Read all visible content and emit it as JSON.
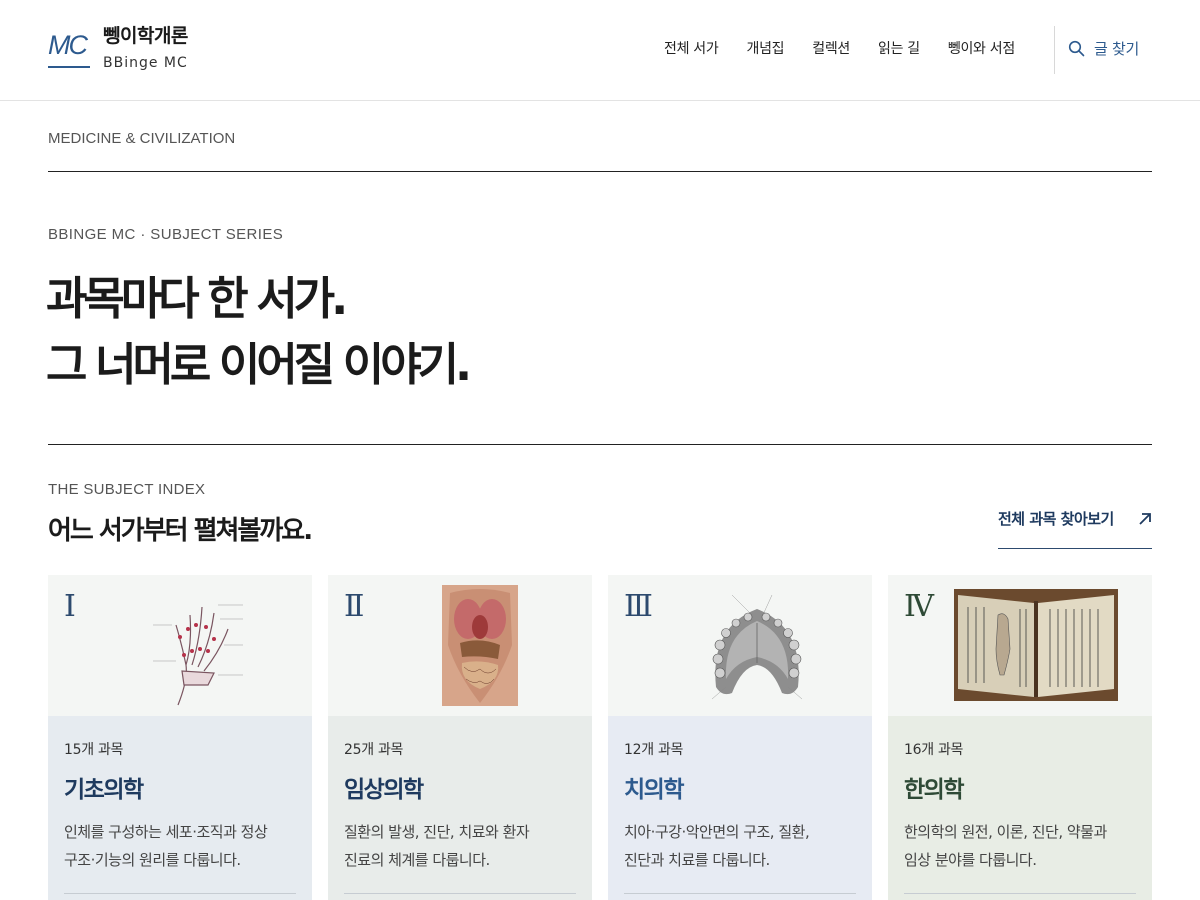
{
  "header": {
    "logo_mark": "MC",
    "logo_title": "뼁이학개론",
    "logo_subtitle": "BBinge MC",
    "nav": [
      "전체 서가",
      "개념집",
      "컬렉션",
      "읽는 길",
      "뼁이와 서점"
    ],
    "search_label": "글 찾기"
  },
  "intro": {
    "kicker": "MEDICINE & CIVILIZATION",
    "series": "BBINGE MC · SUBJECT SERIES",
    "headline_line1": "과목마다 한 서가.",
    "headline_line2": "그 너머로 이어질 이야기."
  },
  "index": {
    "label": "THE SUBJECT INDEX",
    "title": "어느 서가부터 펼쳐볼까요.",
    "browse_label": "전체 과목 찾아보기"
  },
  "cards": [
    {
      "numeral": "Ⅰ",
      "count": "15개 과목",
      "name": "기초의학",
      "desc": "인체를 구성하는 세포·조직과 정상 구조·기능의 원리를 다룹니다.",
      "desc_line1": "인체를 구성하는 세포·조직과 정상",
      "desc_line2": "구조·기능의 원리를 다룹니다.",
      "color": "#e6ebf0",
      "name_color": "#1e3a5f",
      "image": "hand-bones-anatomy-illustration"
    },
    {
      "numeral": "Ⅱ",
      "count": "25개 과목",
      "name": "임상의학",
      "desc": "질환의 발생, 진단, 치료와 환자 진료의 체계를 다룹니다.",
      "desc_line1": "질환의 발생, 진단, 치료와 환자",
      "desc_line2": "진료의 체계를 다룹니다.",
      "color": "#e8ecea",
      "name_color": "#1e3a5f",
      "image": "torso-organs-anatomy-illustration"
    },
    {
      "numeral": "Ⅲ",
      "count": "12개 과목",
      "name": "치의학",
      "desc": "치아·구강·악안면의 구조, 질환, 진단과 치료를 다룹니다.",
      "desc_line1": "치아·구강·악안면의 구조, 질환,",
      "desc_line2": "진단과 치료를 다룹니다.",
      "color": "#e7ebf3",
      "name_color": "#2d5a8e",
      "image": "palate-anatomy-illustration"
    },
    {
      "numeral": "Ⅳ",
      "count": "16개 과목",
      "name": "한의학",
      "desc": "한의학의 원전, 이론, 진단, 약물과 임상 분야를 다룹니다.",
      "desc_line1": "한의학의 원전, 이론, 진단, 약물과",
      "desc_line2": "임상 분야를 다룹니다.",
      "color": "#e8ede5",
      "name_color": "#2e4a36",
      "image": "old-korean-medical-book-photo"
    }
  ]
}
